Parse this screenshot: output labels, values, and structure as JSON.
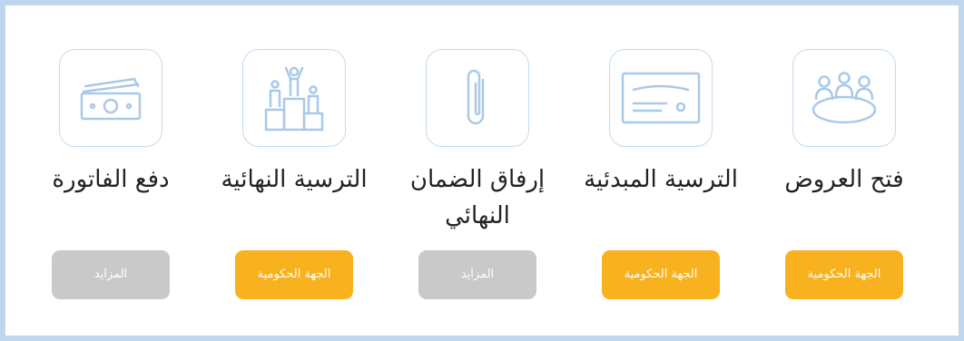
{
  "colors": {
    "frame_border": "#bfd6ec",
    "icon_stroke": "#a9c9e8",
    "government_badge": "#f9b21f",
    "bidder_badge": "#c9c9c9"
  },
  "steps": [
    {
      "icon": "meeting-table-icon",
      "title": "فتح العروض",
      "party": "الجهة الحكومية",
      "party_type": "government"
    },
    {
      "icon": "certificate-icon",
      "title": "الترسية المبدئية",
      "party": "الجهة الحكومية",
      "party_type": "government"
    },
    {
      "icon": "paperclip-icon",
      "title": "إرفاق الضمان النهائي",
      "party": "المزايد",
      "party_type": "bidder"
    },
    {
      "icon": "podium-icon",
      "title": "الترسية النهائية",
      "party": "الجهة الحكومية",
      "party_type": "government"
    },
    {
      "icon": "money-icon",
      "title": "دفع الفاتورة",
      "party": "المزايد",
      "party_type": "bidder"
    }
  ]
}
